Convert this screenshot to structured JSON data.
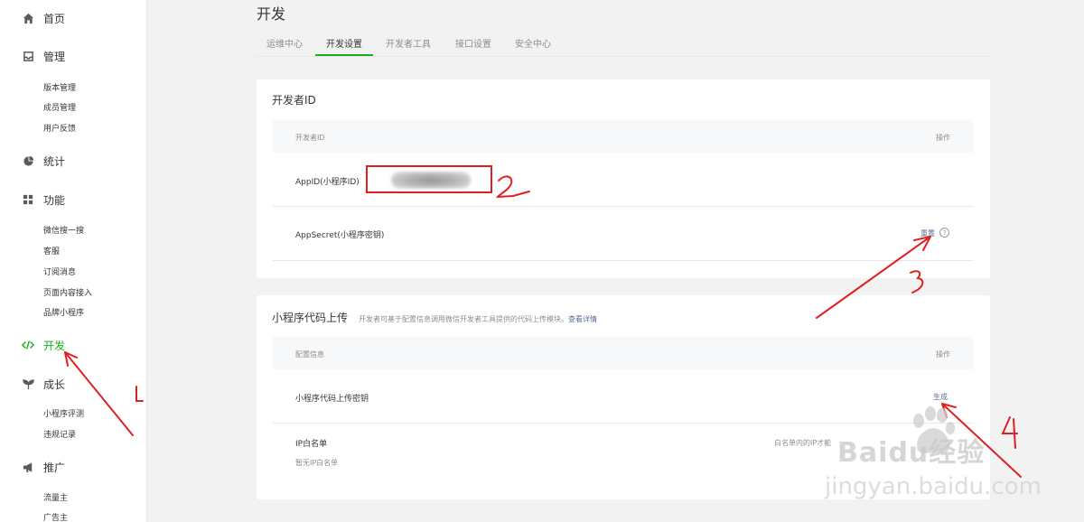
{
  "sidebar": {
    "groups": [
      {
        "label": "首页",
        "icon": "home-icon",
        "items": []
      },
      {
        "label": "管理",
        "icon": "inbox-icon",
        "items": [
          "版本管理",
          "成员管理",
          "用户反馈"
        ]
      },
      {
        "label": "统计",
        "icon": "pie-chart-icon",
        "items": []
      },
      {
        "label": "功能",
        "icon": "grid-icon",
        "items": [
          "微信搜一搜",
          "客服",
          "订阅消息",
          "页面内容接入",
          "品牌小程序"
        ]
      },
      {
        "label": "开发",
        "icon": "code-icon",
        "items": [],
        "active": true
      },
      {
        "label": "成长",
        "icon": "sprout-icon",
        "items": [
          "小程序评测",
          "违规记录"
        ]
      },
      {
        "label": "推广",
        "icon": "megaphone-icon",
        "items": [
          "流量主",
          "广告主"
        ]
      }
    ]
  },
  "main": {
    "title": "开发",
    "tabs": [
      "运维中心",
      "开发设置",
      "开发者工具",
      "接口设置",
      "安全中心"
    ],
    "active_tab": "开发设置"
  },
  "dev_id_panel": {
    "title": "开发者ID",
    "header_left": "开发者ID",
    "header_right": "操作",
    "appid_label": "AppID(小程序ID)",
    "appsecret_label": "AppSecret(小程序密钥)",
    "reset_link": "重置",
    "help_icon": "question-circle-icon"
  },
  "upload_panel": {
    "title": "小程序代码上传",
    "desc": "开发者可基于配置信息调用微信开发者工具提供的代码上传模块。",
    "desc_link": "查看详情",
    "header_left": "配置信息",
    "header_right": "操作",
    "key_label": "小程序代码上传密钥",
    "generate_link": "生成",
    "ip_label": "IP白名单",
    "ip_empty": "暂无IP白名单",
    "ip_note": "白名单内的IP才能"
  },
  "annotations": {
    "numbers": [
      "1",
      "2",
      "3",
      "4"
    ],
    "color": "#e02020"
  },
  "watermark": {
    "brand": "Baidu经验",
    "url": "jingyan.baidu.com"
  },
  "colors": {
    "accent": "#1aad19",
    "link": "#576b95",
    "annotation": "#e02020"
  }
}
